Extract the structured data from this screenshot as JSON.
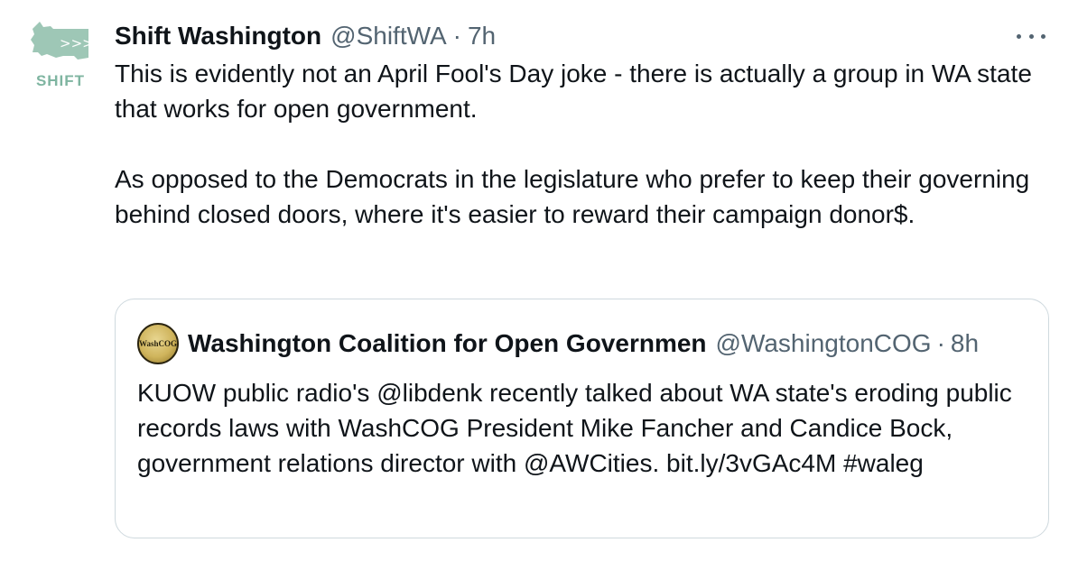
{
  "tweet": {
    "avatar_label": "SHIFT",
    "display_name": "Shift Washington",
    "handle": "@ShiftWA",
    "separator": "·",
    "time": "7h",
    "text_paragraphs": [
      "This is evidently not an April Fool's Day joke - there is actually a group in WA state that works for open government.",
      "As opposed to the Democrats in the legislature who prefer to keep their governing behind closed doors, where it's easier to reward their campaign donor$."
    ],
    "more_icon": "more-horizontal-icon"
  },
  "quoted_tweet": {
    "avatar_label": "WashCOG",
    "display_name": "Washington Coalition for Open Governmen",
    "handle": "@WashingtonCOG",
    "separator": "·",
    "time": "8h",
    "text": "KUOW public radio's @libdenk recently talked about WA state's eroding public records laws with WashCOG President Mike Fancher and Candice Bock, government relations director with @AWCities. bit.ly/3vGAc4M #waleg"
  },
  "colors": {
    "text_primary": "#0f1419",
    "text_secondary": "#536471",
    "border": "#cfd9de",
    "shift_green": "#7fb5a1"
  }
}
